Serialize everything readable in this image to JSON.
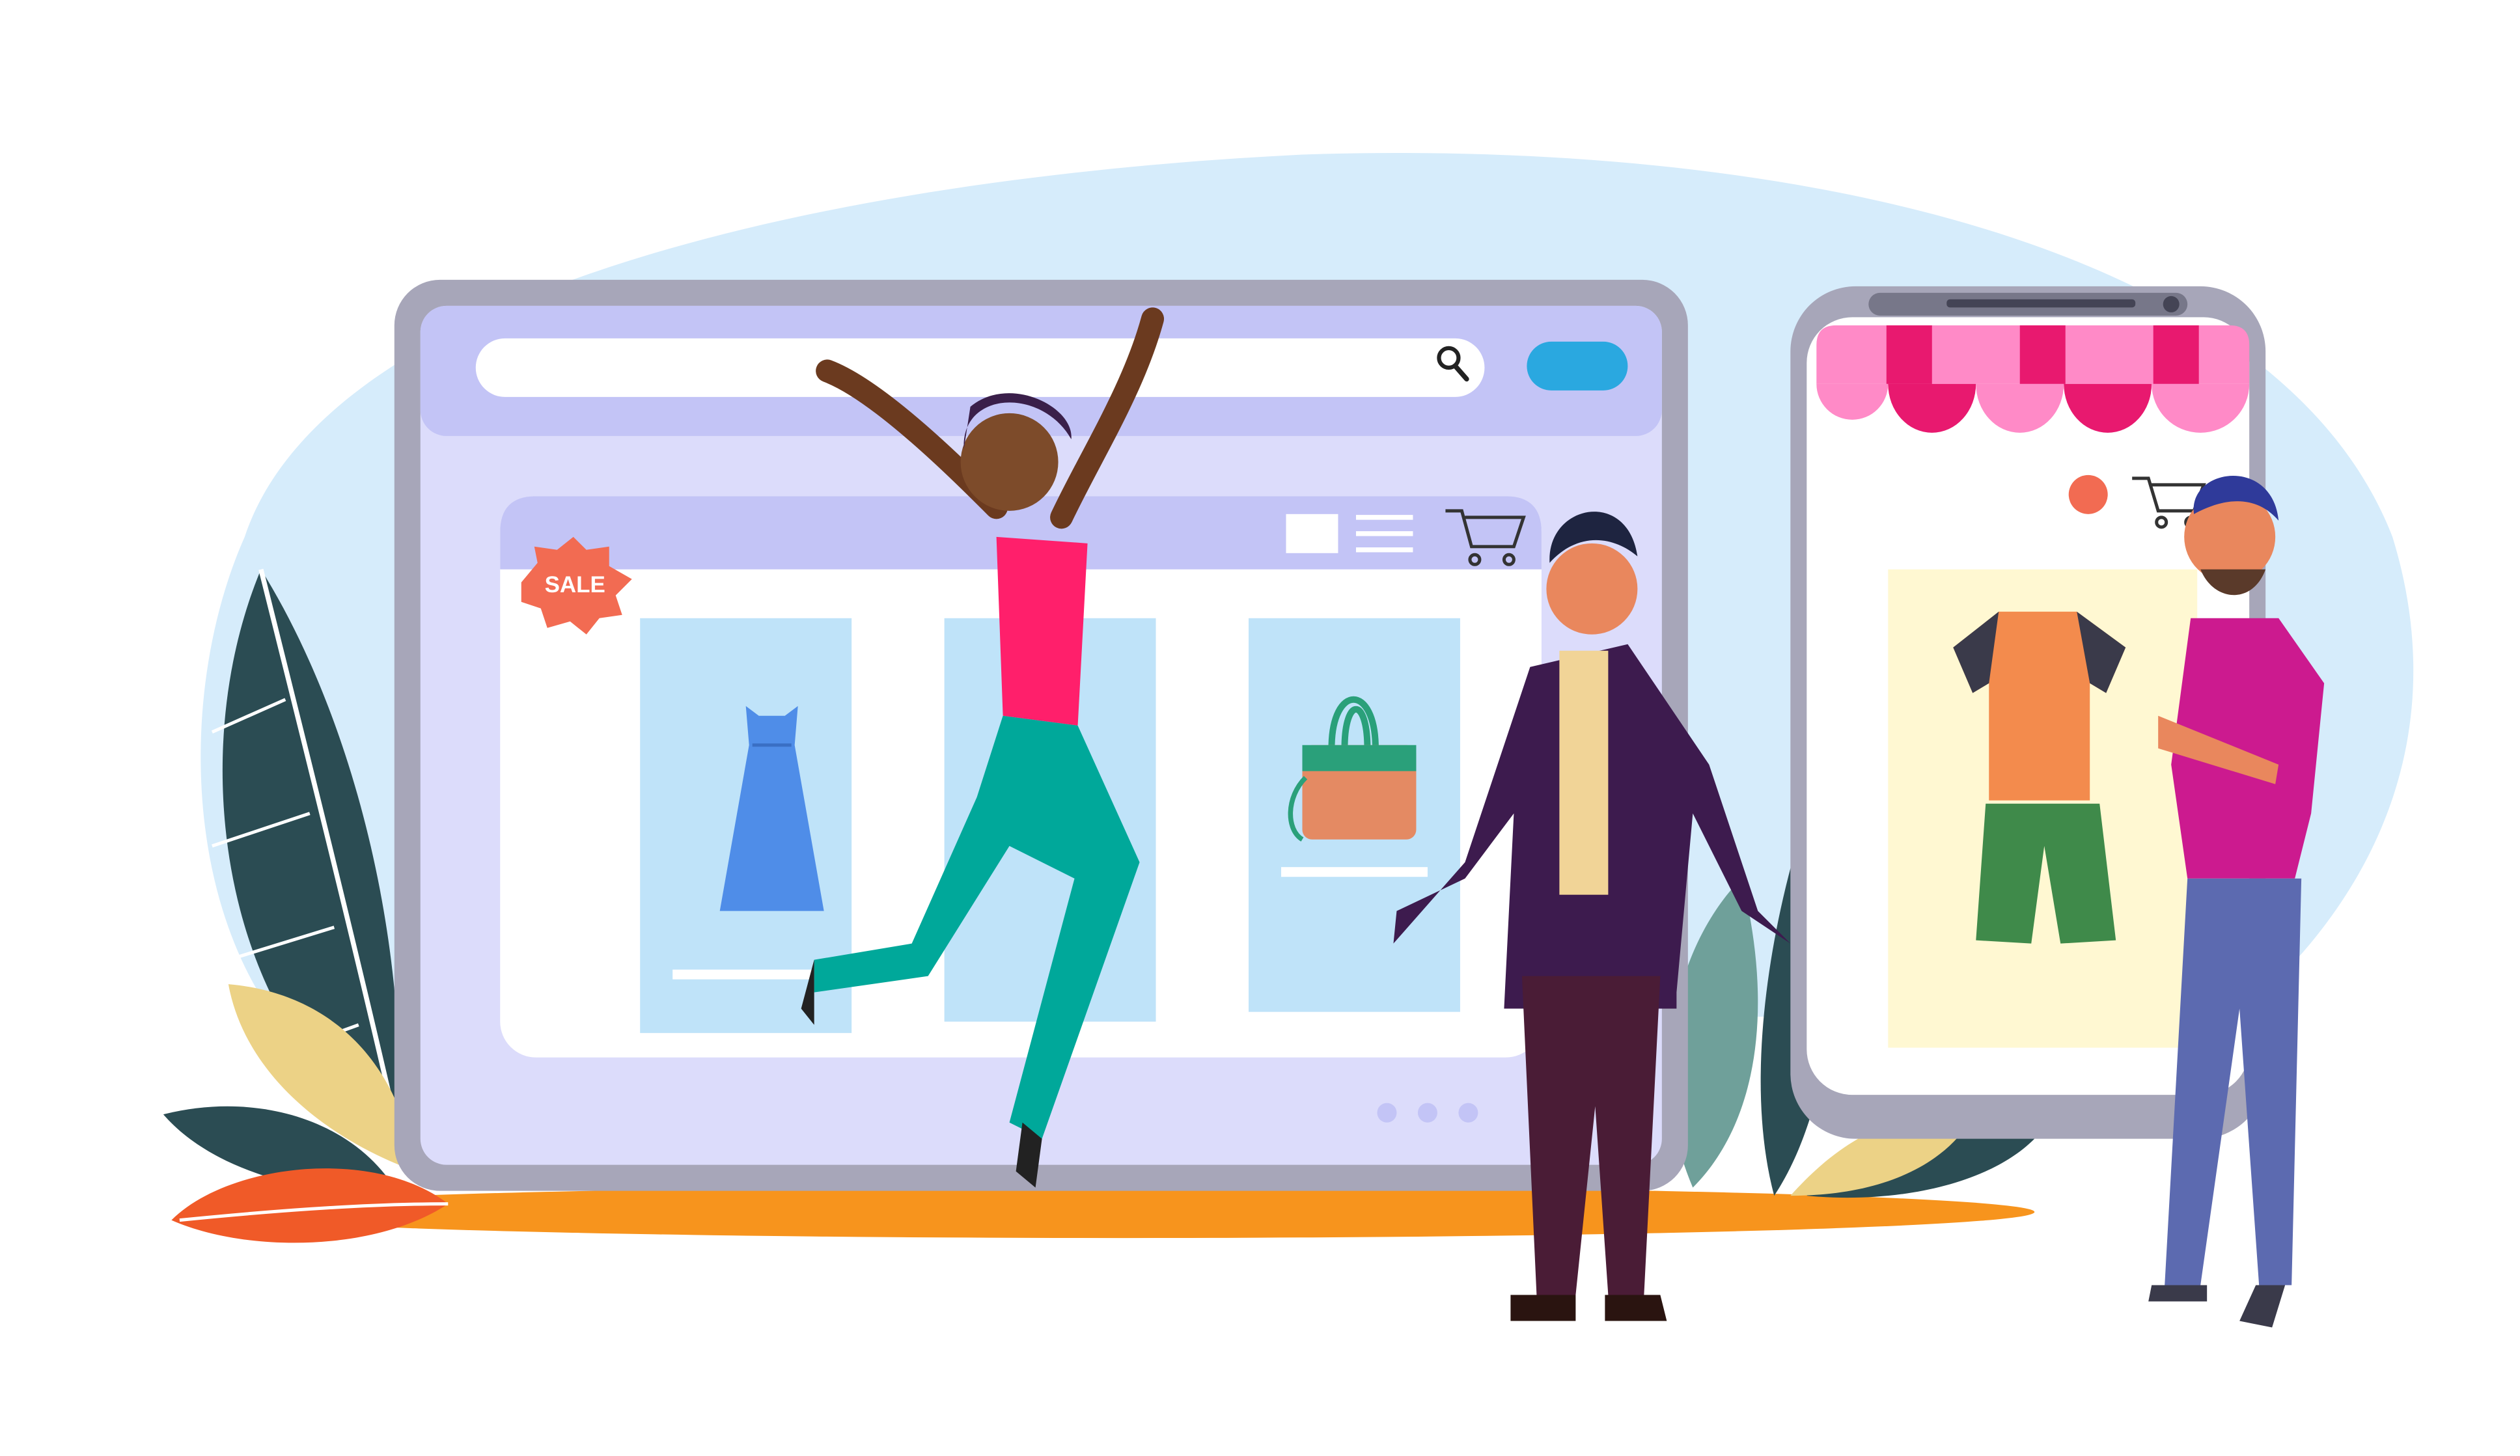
{
  "illustration": {
    "sale_badge": {
      "label": "SALE"
    },
    "browser": {
      "search": {
        "placeholder": "",
        "icon": "search-icon"
      },
      "go_button": {
        "icon": "pill-button"
      },
      "toolbar_icons": [
        "grid-view-icon",
        "list-view-icon",
        "cart-icon"
      ],
      "products": [
        {
          "icon": "dress-icon"
        },
        {
          "icon": "blank-product"
        },
        {
          "icon": "handbag-icon"
        }
      ],
      "pager_dots": 3
    },
    "phone": {
      "awning": {
        "icon": "shop-awning-icon"
      },
      "cart": {
        "icon": "cart-icon"
      },
      "product": {
        "icon": "tshirt-and-shorts-icon"
      }
    },
    "people": [
      "jumping-woman",
      "surprised-man",
      "bearded-man-arms-crossed"
    ],
    "colors": {
      "sky": "#d6ecfb",
      "frame": "#a7a6b9",
      "screen": "#dcdcfb",
      "bar": "#c3c4f6",
      "card": "#bfe3f9",
      "ground": "#f7941d",
      "sale": "#f26b52",
      "awning_pink": "#ff8ac7",
      "awning_red": "#e8196f",
      "leaf_dark": "#2b4c53",
      "leaf_orange": "#f05a28"
    }
  }
}
